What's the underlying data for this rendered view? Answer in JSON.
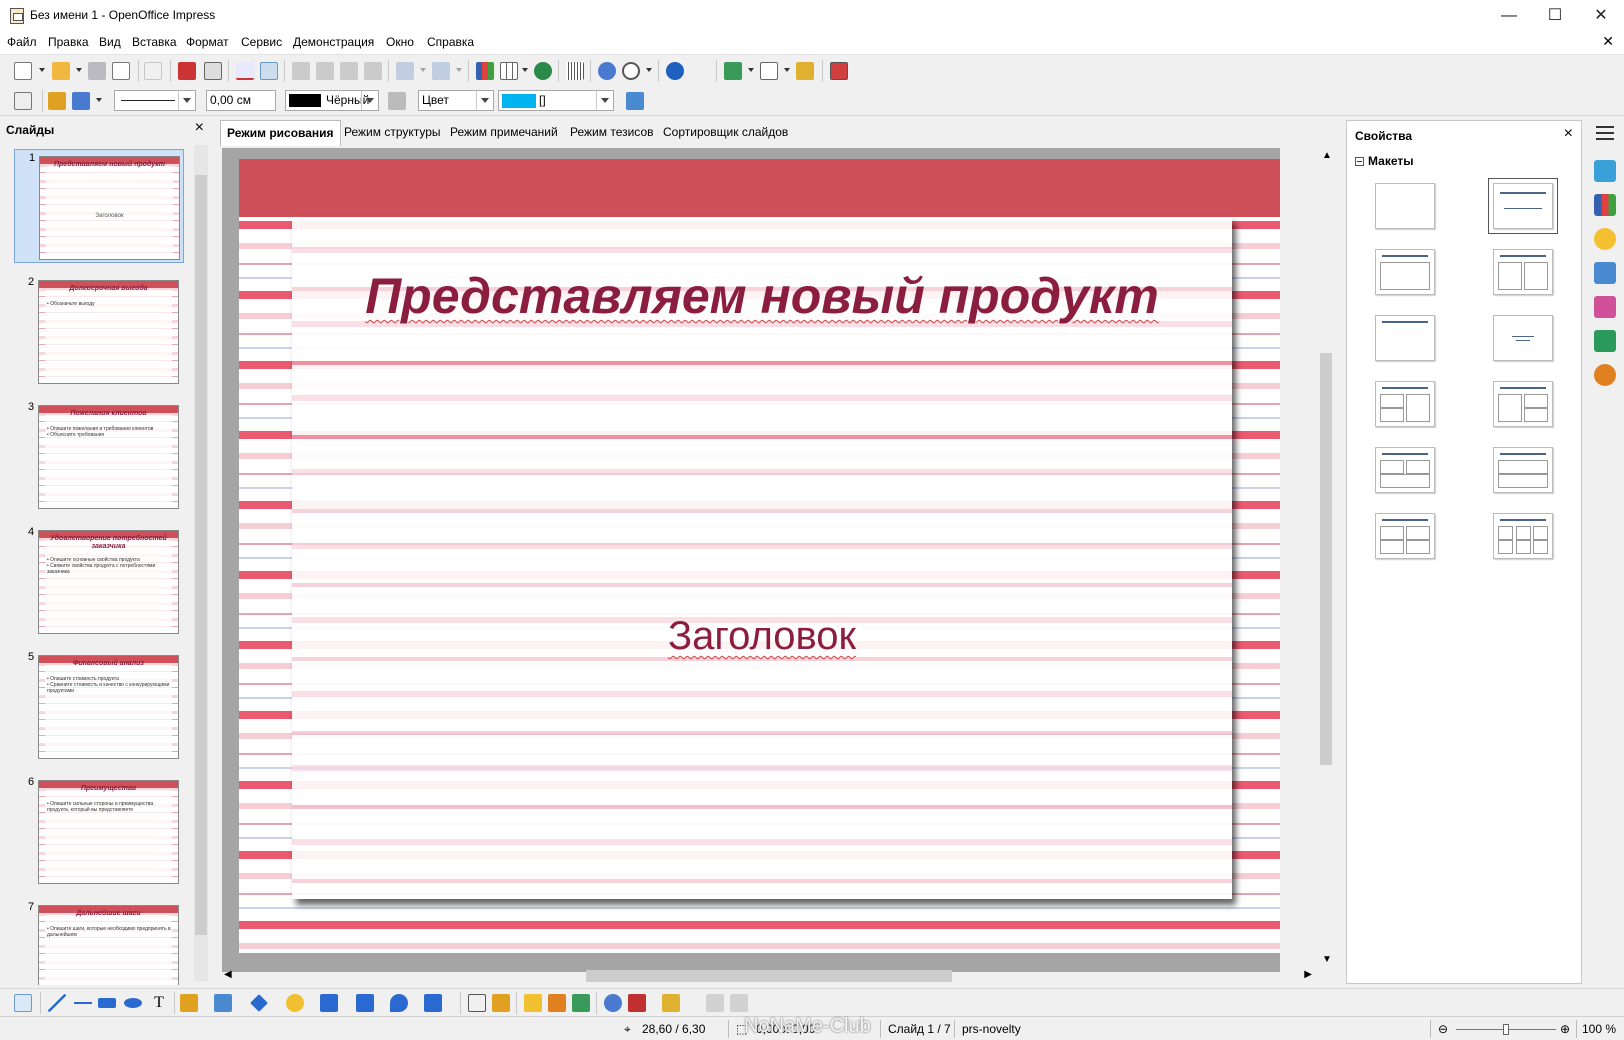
{
  "window": {
    "title": "Без имени 1 - OpenOffice Impress",
    "minimize": "—",
    "maximize": "☐",
    "close": "✕",
    "doc_close": "✕"
  },
  "menu": [
    "Файл",
    "Правка",
    "Вид",
    "Вставка",
    "Формат",
    "Сервис",
    "Демонстрация",
    "Окно",
    "Справка"
  ],
  "line_toolbar": {
    "line_width": "0,00 см",
    "line_color": "Чёрный",
    "fill_type": "Цвет",
    "fill_value": "[]"
  },
  "slides_panel": {
    "title": "Слайды",
    "slides": [
      {
        "num": "1",
        "title": "Представляем новый продукт",
        "bullets": [],
        "center": "Заголовок"
      },
      {
        "num": "2",
        "title": "Долгосрочная выгода",
        "bullets": [
          "Обозначьте выгоду"
        ],
        "center": ""
      },
      {
        "num": "3",
        "title": "Пожелания клиентов",
        "bullets": [
          "Опишите пожелания и требования клиентов",
          "Объясните требования"
        ],
        "center": ""
      },
      {
        "num": "4",
        "title": "Удовлетворение потребностей заказчика",
        "bullets": [
          "Опишите основные свойства продукта",
          "Свяжите свойства продукта с потребностями заказчика"
        ],
        "center": ""
      },
      {
        "num": "5",
        "title": "Финансовый анализ",
        "bullets": [
          "Опишите стоимость продукта",
          "Сравните стоимость и качество с конкурирующими продуктами"
        ],
        "center": ""
      },
      {
        "num": "6",
        "title": "Преимущества",
        "bullets": [
          "Опишите сильные стороны и преимущества продукта, который вы представляете"
        ],
        "center": ""
      },
      {
        "num": "7",
        "title": "Дальнейшие шаги",
        "bullets": [
          "Опишите шаги, которые необходимо предпринять в дальнейшем"
        ],
        "center": ""
      }
    ]
  },
  "view_tabs": [
    "Режим рисования",
    "Режим структуры",
    "Режим примечаний",
    "Режим тезисов",
    "Сортировщик слайдов"
  ],
  "slide": {
    "title": "Представляем новый продукт",
    "subtitle": "Заголовок"
  },
  "properties": {
    "title": "Свойства",
    "section": "Макеты"
  },
  "status": {
    "position": "28,60 / 6,30",
    "size": "0,00 x 0,00",
    "slide": "Слайд 1 / 7",
    "template": "prs-novelty",
    "zoom": "100 %",
    "zoom_level": 0.5
  },
  "watermark": "NoNaMe-Club",
  "colors": {
    "accent_red": "#d05059",
    "title_color": "#8b1e3f",
    "fill_blue": "#00b4f0"
  }
}
